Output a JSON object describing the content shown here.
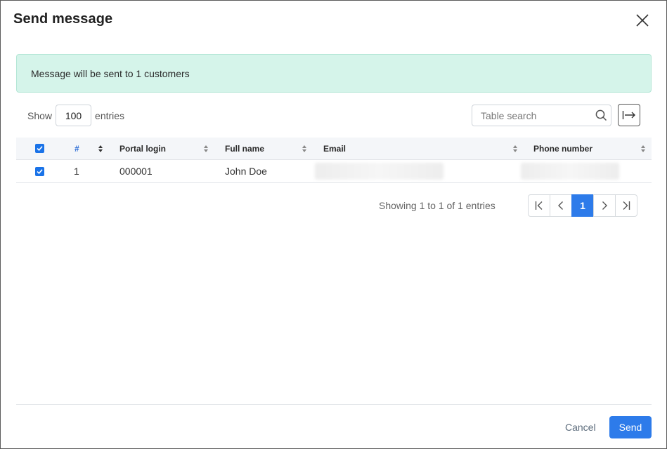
{
  "dialog": {
    "title": "Send message"
  },
  "alert": {
    "message": "Message will be sent to 1 customers"
  },
  "length": {
    "show_label": "Show",
    "value": "100",
    "entries_label": "entries"
  },
  "search": {
    "placeholder": "Table search"
  },
  "table": {
    "columns": [
      "#",
      "Portal login",
      "Full name",
      "Email",
      "Phone number"
    ],
    "rows": [
      {
        "selected": true,
        "index": "1",
        "portal_login": "000001",
        "full_name": "John Doe"
      }
    ]
  },
  "pagination": {
    "info": "Showing 1 to 1 of 1 entries",
    "current_page": "1"
  },
  "footer": {
    "cancel_label": "Cancel",
    "send_label": "Send"
  },
  "colors": {
    "primary": "#2d7bea",
    "alert_bg": "#d5f4ea"
  }
}
